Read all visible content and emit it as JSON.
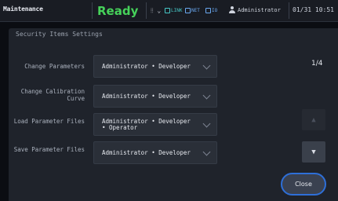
{
  "topbar": {
    "mode": "Maintenance",
    "status": "Ready",
    "menu_glyph": "⦙⦙ ⌄",
    "connections": [
      {
        "label": "LINK",
        "color": "#46c6c6",
        "icon": "link-icon"
      },
      {
        "label": "NET",
        "color": "#6aa8f0",
        "icon": "network-icon"
      },
      {
        "label": "IO",
        "color": "#6aa8f0",
        "icon": "io-icon"
      }
    ],
    "user": "Administrator",
    "datetime": "01/31 10:51"
  },
  "dialog": {
    "title": "Security Items Settings",
    "rows": [
      {
        "label": "Change Parameters",
        "value": "Administrator • Developer"
      },
      {
        "label": "Change Calibration Curve",
        "value": "Administrator • Developer"
      },
      {
        "label": "Load Parameter Files",
        "value": "Administrator • Developer",
        "value2": "• Operator"
      },
      {
        "label": "Save Parameter Files",
        "value": "Administrator • Developer"
      }
    ],
    "page_indicator": "1/4",
    "up_glyph": "▲",
    "down_glyph": "▼",
    "close_label": "Close"
  },
  "colors": {
    "accent": "#2e6fd8",
    "ready": "#46d25a"
  }
}
